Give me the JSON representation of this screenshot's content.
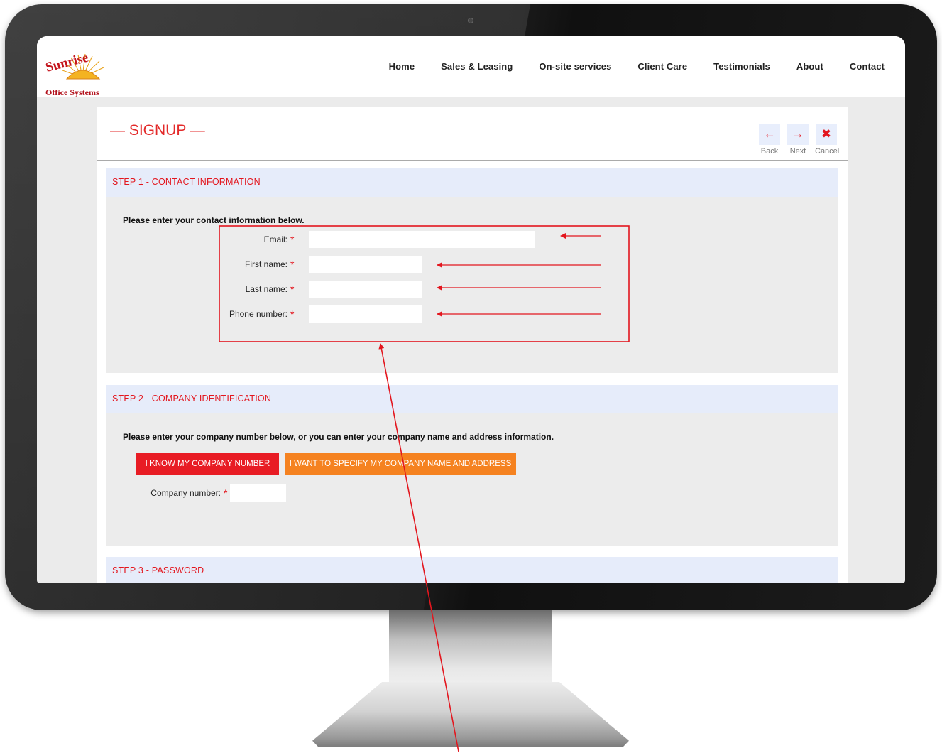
{
  "brand": {
    "logo_word": "Sunrise",
    "logo_subtitle": "Office Systems",
    "accent": "#e3161e",
    "secondary_accent": "#f58220"
  },
  "nav": {
    "items": [
      {
        "label": "Home"
      },
      {
        "label": "Sales & Leasing"
      },
      {
        "label": "On-site services"
      },
      {
        "label": "Client Care"
      },
      {
        "label": "Testimonials"
      },
      {
        "label": "About"
      },
      {
        "label": "Contact"
      }
    ]
  },
  "page": {
    "title": "— SIGNUP —"
  },
  "wizard": {
    "back_label": "Back",
    "next_label": "Next",
    "cancel_label": "Cancel",
    "back_icon": "arrow-left-icon",
    "next_icon": "arrow-right-icon",
    "cancel_icon": "close-icon"
  },
  "step1": {
    "header": "STEP 1 - CONTACT INFORMATION",
    "intro": "Please enter your contact information below.",
    "required_mark": "*",
    "fields": [
      {
        "label": "Email:",
        "value": ""
      },
      {
        "label": "First name:",
        "value": ""
      },
      {
        "label": "Last name:",
        "value": ""
      },
      {
        "label": "Phone number:",
        "value": ""
      }
    ]
  },
  "step2": {
    "header": "STEP 2 - COMPANY IDENTIFICATION",
    "intro": "Please enter your company number below, or you can enter your company name and address information.",
    "button_company_number": "I KNOW MY COMPANY NUMBER",
    "button_company_name": "I WANT TO SPECIFY MY COMPANY NAME AND ADDRESS",
    "company_number_label": "Company number:",
    "required_mark": "*",
    "company_number_value": ""
  },
  "step3": {
    "header": "STEP 3 - PASSWORD"
  }
}
